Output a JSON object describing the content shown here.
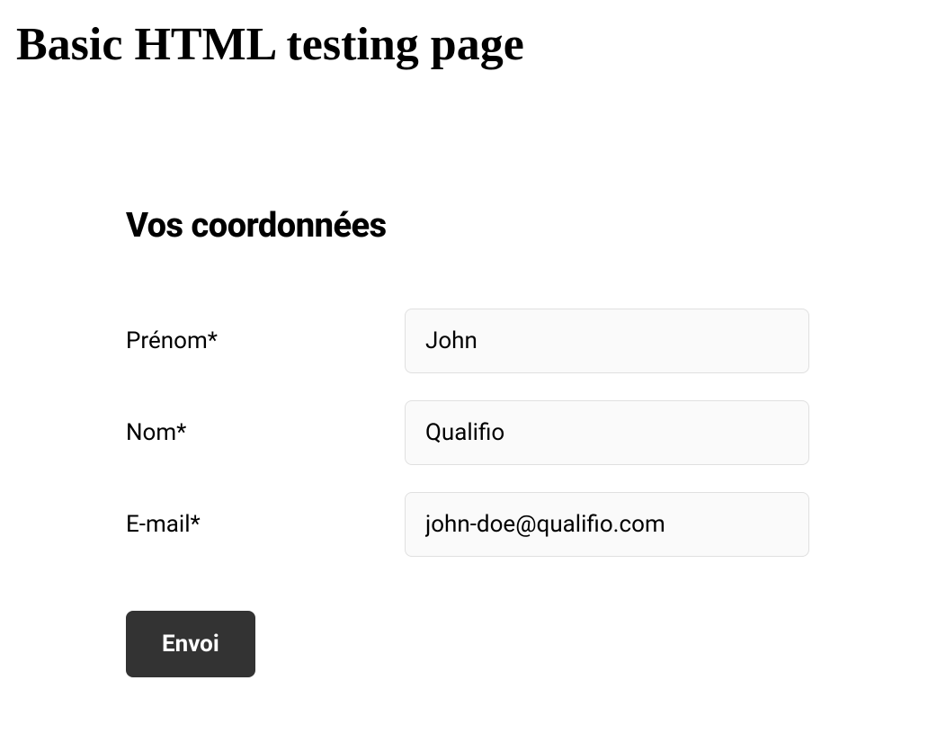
{
  "header": {
    "title": "Basic HTML testing page"
  },
  "form": {
    "heading": "Vos coordonnées",
    "fields": {
      "firstname": {
        "label": "Prénom*",
        "value": "John"
      },
      "lastname": {
        "label": "Nom*",
        "value": "Qualifio"
      },
      "email": {
        "label": "E-mail*",
        "value": "john-doe@qualifio.com"
      }
    },
    "submit_label": "Envoi"
  }
}
